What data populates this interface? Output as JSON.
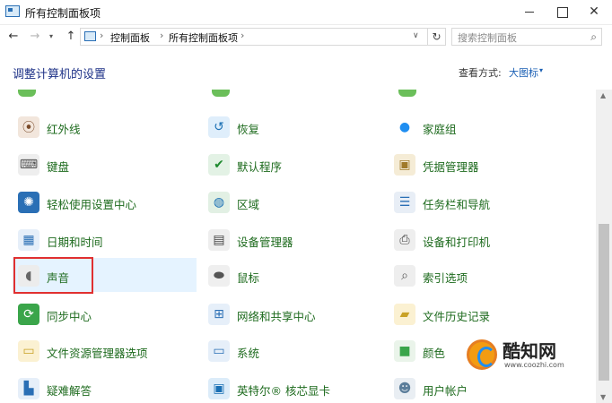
{
  "window": {
    "title": "所有控制面板项",
    "minimize": "",
    "maximize": "",
    "close": "✕"
  },
  "nav": {
    "back": "←",
    "forward": "→",
    "recent": "▾",
    "up": "↑",
    "breadcrumbs": [
      "控制面板",
      "所有控制面板项"
    ],
    "separator": "›",
    "dropdown": "∨",
    "refresh": "↻",
    "search_placeholder": "搜索控制面板",
    "search_icon": "⌕"
  },
  "header": {
    "title": "调整计算机的设置",
    "view_by_label": "查看方式:",
    "view_by_value": "大图标",
    "view_by_arrow": "▾"
  },
  "items": [
    {
      "id": "infrared",
      "label": "红外线",
      "icon": "infrared-icon",
      "glyph": "⦿",
      "color": "#7a4b2a",
      "bg": "#f2e6dc"
    },
    {
      "id": "recovery",
      "label": "恢复",
      "icon": "recovery-icon",
      "glyph": "↺",
      "color": "#1a6fb4",
      "bg": "#dfeefb"
    },
    {
      "id": "homegroup",
      "label": "家庭组",
      "icon": "homegroup-icon",
      "glyph": "●",
      "color": "#1f8ef1",
      "bg": "#ffffff"
    },
    {
      "id": "keyboard",
      "label": "键盘",
      "icon": "keyboard-icon",
      "glyph": "⌨",
      "color": "#555555",
      "bg": "#eeeeee"
    },
    {
      "id": "default-programs",
      "label": "默认程序",
      "icon": "default-programs-icon",
      "glyph": "✔",
      "color": "#1e8a2e",
      "bg": "#e3f2e5"
    },
    {
      "id": "credential-manager",
      "label": "凭据管理器",
      "icon": "credential-manager-icon",
      "glyph": "▣",
      "color": "#a07a2a",
      "bg": "#f5ecd6"
    },
    {
      "id": "ease-of-access",
      "label": "轻松使用设置中心",
      "icon": "ease-of-access-icon",
      "glyph": "✺",
      "color": "#ffffff",
      "bg": "#2a6fb5"
    },
    {
      "id": "region",
      "label": "区域",
      "icon": "region-icon",
      "glyph": "◍",
      "color": "#1a6fb4",
      "bg": "#e2f0e4"
    },
    {
      "id": "taskbar",
      "label": "任务栏和导航",
      "icon": "taskbar-icon",
      "glyph": "☰",
      "color": "#2a6fb5",
      "bg": "#e8eef6"
    },
    {
      "id": "date-time",
      "label": "日期和时间",
      "icon": "date-time-icon",
      "glyph": "▦",
      "color": "#2a6fb5",
      "bg": "#e6eff9"
    },
    {
      "id": "device-manager",
      "label": "设备管理器",
      "icon": "device-manager-icon",
      "glyph": "▤",
      "color": "#444444",
      "bg": "#eeeeee"
    },
    {
      "id": "devices-printers",
      "label": "设备和打印机",
      "icon": "devices-printers-icon",
      "glyph": "⎙",
      "color": "#444444",
      "bg": "#eeeeee"
    },
    {
      "id": "sound",
      "label": "声音",
      "icon": "speaker-icon",
      "glyph": "◖",
      "color": "#666666",
      "bg": "#ececec"
    },
    {
      "id": "mouse",
      "label": "鼠标",
      "icon": "mouse-icon",
      "glyph": "⬬",
      "color": "#555555",
      "bg": "#efefef"
    },
    {
      "id": "indexing",
      "label": "索引选项",
      "icon": "indexing-icon",
      "glyph": "⌕",
      "color": "#555555",
      "bg": "#eeeeee"
    },
    {
      "id": "sync-center",
      "label": "同步中心",
      "icon": "sync-center-icon",
      "glyph": "⟳",
      "color": "#ffffff",
      "bg": "#3aa54a"
    },
    {
      "id": "network-sharing",
      "label": "网络和共享中心",
      "icon": "network-sharing-icon",
      "glyph": "⊞",
      "color": "#2a6fb5",
      "bg": "#e6eff9"
    },
    {
      "id": "file-history",
      "label": "文件历史记录",
      "icon": "file-history-icon",
      "glyph": "▰",
      "color": "#c9a227",
      "bg": "#fbf1d2"
    },
    {
      "id": "file-explorer-options",
      "label": "文件资源管理器选项",
      "icon": "folder-options-icon",
      "glyph": "▭",
      "color": "#c9a227",
      "bg": "#fbf1d2"
    },
    {
      "id": "system",
      "label": "系统",
      "icon": "system-icon",
      "glyph": "▭",
      "color": "#2a6fb5",
      "bg": "#e6eff9"
    },
    {
      "id": "color-management",
      "label": "颜色",
      "icon": "color-management-icon",
      "glyph": "■",
      "color": "#3aa54a",
      "bg": "#eaf4ea"
    },
    {
      "id": "troubleshooting",
      "label": "疑难解答",
      "icon": "troubleshooting-icon",
      "glyph": "▙",
      "color": "#2a6fb5",
      "bg": "#e6eff9"
    },
    {
      "id": "intel-graphics",
      "label": "英特尔® 核芯显卡",
      "icon": "intel-graphics-icon",
      "glyph": "▣",
      "color": "#1a6fb4",
      "bg": "#dcecf9"
    },
    {
      "id": "user-accounts",
      "label": "用户帐户",
      "icon": "user-accounts-icon",
      "glyph": "☻",
      "color": "#5a7d9a",
      "bg": "#e9eef3"
    }
  ],
  "scrollbar": {
    "up": "▲",
    "down": "▼"
  },
  "watermark": {
    "name": "酷知网",
    "url": "www.coozhi.com"
  },
  "colors": {
    "link_green": "#1e6b1e",
    "header_blue": "#1e3287",
    "highlight_bg": "#e5f3ff",
    "highlight_border": "#e03030"
  }
}
